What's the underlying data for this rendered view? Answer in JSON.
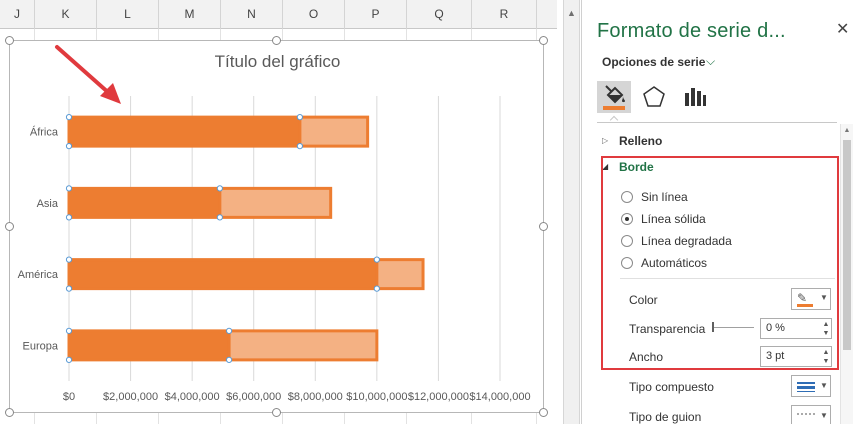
{
  "spreadsheet": {
    "columns": [
      "J",
      "K",
      "L",
      "M",
      "N",
      "O",
      "P",
      "Q",
      "R"
    ]
  },
  "chart": {
    "title": "Título del gráfico",
    "arrow_color": "#e03a3e",
    "selection_handle_color": "#5b9bd5"
  },
  "chart_data": {
    "type": "bar",
    "orientation": "horizontal",
    "stacked": true,
    "title": "Título del gráfico",
    "categories": [
      "África",
      "Asia",
      "América",
      "Europa"
    ],
    "series": [
      {
        "values": [
          7500000,
          4900000,
          10000000,
          5200000
        ],
        "color": "#ed7d31"
      },
      {
        "values": [
          2200000,
          3600000,
          1500000,
          4800000
        ],
        "color": "#f4b183"
      }
    ],
    "xlim": [
      0,
      14000000
    ],
    "x_ticks": [
      "$0",
      "$2,000,000",
      "$4,000,000",
      "$6,000,000",
      "$8,000,000",
      "$10,000,000",
      "$12,000,000",
      "$14,000,000"
    ],
    "grid": true
  },
  "pane": {
    "title": "Formato de serie d...",
    "close_glyph": "✕",
    "series_options_label": "Opciones de serie",
    "series_options_chevron": "⌵",
    "tabs": [
      {
        "name": "fill-line",
        "icon": "paint-bucket-icon"
      },
      {
        "name": "effects",
        "icon": "pentagon-icon"
      },
      {
        "name": "series-options",
        "icon": "bar-chart-icon"
      }
    ],
    "sections": {
      "relleno": "Relleno",
      "borde": "Borde"
    },
    "border_options": [
      {
        "label": "Sin línea",
        "selected": false
      },
      {
        "label": "Línea sólida",
        "selected": true
      },
      {
        "label": "Línea degradada",
        "selected": false
      },
      {
        "label": "Automáticos",
        "selected": false
      }
    ],
    "color_label": "Color",
    "color_value": "#ed7d31",
    "transparency_label": "Transparencia",
    "transparency_value": "0 %",
    "transparency_fraction": 0,
    "width_label": "Ancho",
    "width_value": "3 pt",
    "compound_label": "Tipo compuesto",
    "dash_label": "Tipo de guion",
    "accent_color": "#217346",
    "highlight_color": "#e03a3e"
  }
}
